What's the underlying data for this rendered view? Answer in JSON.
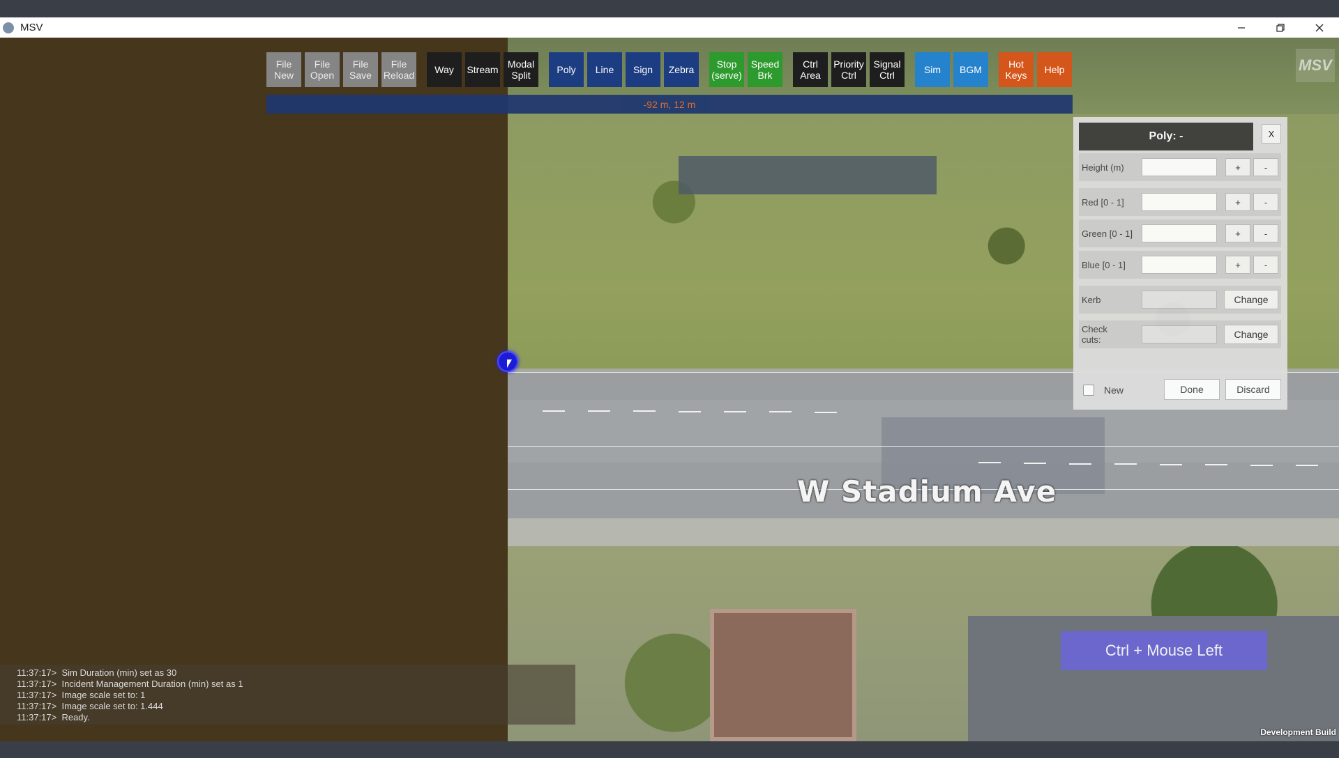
{
  "window": {
    "title": "MSV",
    "controls": [
      "minimize",
      "restore",
      "close"
    ]
  },
  "toolbar": {
    "buttons": [
      {
        "label": "File\nNew",
        "style": "file"
      },
      {
        "label": "File\nOpen",
        "style": "file"
      },
      {
        "label": "File\nSave",
        "style": "file"
      },
      {
        "label": "File\nReload",
        "style": "file"
      },
      {
        "label": "Way",
        "style": "black"
      },
      {
        "label": "Stream",
        "style": "black"
      },
      {
        "label": "Modal\nSplit",
        "style": "black"
      },
      {
        "label": "Poly",
        "style": "darkblue"
      },
      {
        "label": "Line",
        "style": "darkblue"
      },
      {
        "label": "Sign",
        "style": "darkblue"
      },
      {
        "label": "Zebra",
        "style": "darkblue"
      },
      {
        "label": "Stop\n(serve)",
        "style": "green"
      },
      {
        "label": "Speed\nBrk",
        "style": "green"
      },
      {
        "label": "Ctrl\nArea",
        "style": "black"
      },
      {
        "label": "Priority\nCtrl",
        "style": "black"
      },
      {
        "label": "Signal\nCtrl",
        "style": "black"
      },
      {
        "label": "Sim",
        "style": "blue"
      },
      {
        "label": "BGM",
        "style": "blue"
      },
      {
        "label": "Hot\nKeys",
        "style": "orange"
      },
      {
        "label": "Help",
        "style": "orange"
      }
    ]
  },
  "coords": "-92 m, 12 m",
  "panel": {
    "title": "Poly: -",
    "close_label": "X",
    "rows": [
      {
        "label": "Height (m)",
        "value": "",
        "plus": "+",
        "minus": "-"
      },
      {
        "label": "Red [0 - 1]",
        "value": "",
        "plus": "+",
        "minus": "-"
      },
      {
        "label": "Green [0 - 1]",
        "value": "",
        "plus": "+",
        "minus": "-"
      },
      {
        "label": "Blue [0 - 1]",
        "value": "",
        "plus": "+",
        "minus": "-"
      }
    ],
    "kerb": {
      "label": "Kerb",
      "value": "",
      "button": "Change"
    },
    "check_cuts": {
      "label": "Check\ncuts:",
      "value": "",
      "button": "Change"
    },
    "new_label": "New",
    "new_checked": false,
    "done_label": "Done",
    "discard_label": "Discard"
  },
  "hint": "Ctrl + Mouse Left",
  "map": {
    "street_label": "W Stadium Ave",
    "watermark": "MSV",
    "build_label": "Development Build"
  },
  "log": [
    "11:37:17>  Sim Duration (min) set as 30",
    "11:37:17>  Incident Management Duration (min) set as 1",
    "11:37:17>  Image scale set to: 1",
    "11:37:17>  Image scale set to: 1.444",
    "11:37:17>  Ready."
  ],
  "colors": {
    "canvas_bg": "#46361c",
    "button_file": "#858585",
    "button_black": "#1e1e1e",
    "button_darkblue": "#1d3d82",
    "button_green": "#2d9a2e",
    "button_blue": "#2582cc",
    "button_orange": "#d5561a",
    "coord_text": "#e86b2a",
    "hint_bg": "#6b66d6"
  }
}
